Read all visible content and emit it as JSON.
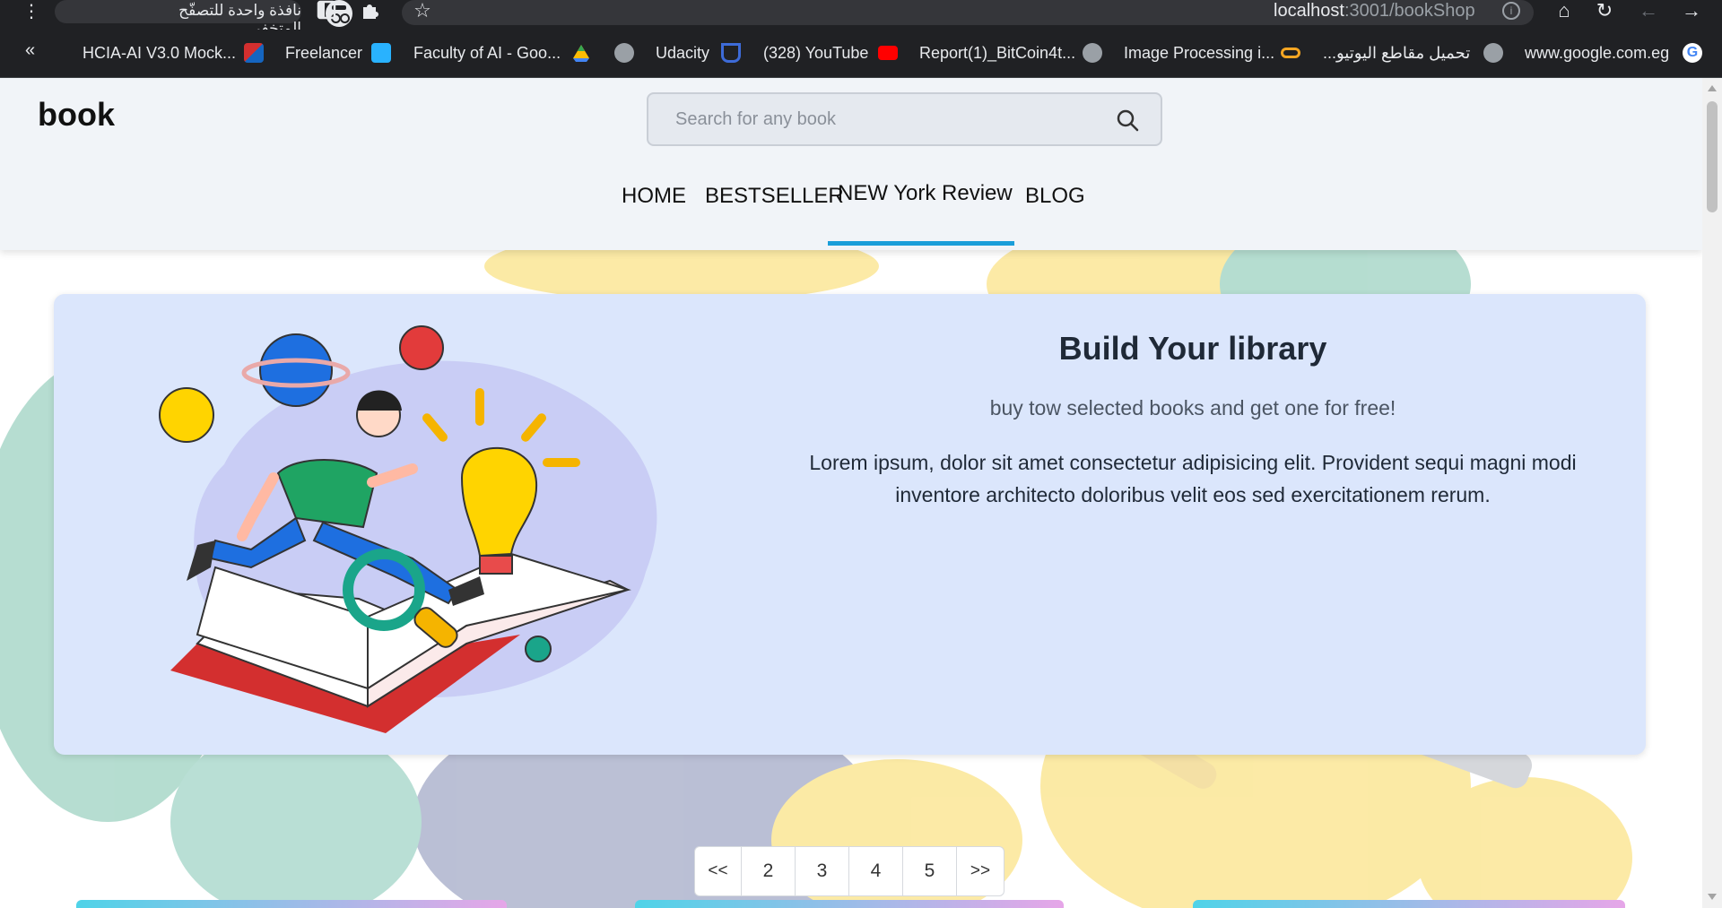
{
  "browser": {
    "incognito_label": "نافذة واحدة للتصفّح المتخفي",
    "url_host": "localhost",
    "url_path": ":3001/bookShop",
    "bookmarks": [
      {
        "label": "HCIA-AI V3.0 Mock...",
        "icon": "huawei-icon"
      },
      {
        "label": "Freelancer",
        "icon": "freelancer-icon"
      },
      {
        "label": "Faculty of AI - Goo...",
        "icon": "google-drive-icon"
      },
      {
        "label": "Udacity",
        "icon": "globe-icon"
      },
      {
        "label": "(328) YouTube",
        "icon": "udacity-icon"
      },
      {
        "label": "Report(1)_BitCoin4t...",
        "icon": "youtube-icon"
      },
      {
        "label": "Image Processing i...",
        "icon": "globe-icon"
      },
      {
        "label": "تحميل مقاطع اليوتيو...",
        "icon": "coursera-icon"
      },
      {
        "label": "www.google.com.eg",
        "icon": "globe-icon"
      }
    ],
    "overflow_chevron": "«"
  },
  "header": {
    "brand": "book",
    "search_placeholder": "Search for any book",
    "nav": [
      {
        "label": "HOME",
        "active": false
      },
      {
        "label": "BESTSELLER",
        "active": false
      },
      {
        "label": "NEW York Review",
        "active": true
      },
      {
        "label": "BLOG",
        "active": false
      }
    ],
    "accent_color": "#1a9ed9"
  },
  "hero": {
    "title": "Build Your library",
    "subtitle": "buy tow selected books and get one for free!",
    "body": "Lorem ipsum, dolor sit amet consectetur adipisicing elit. Provident sequi magni modi inventore architecto doloribus velit eos sed exercitationem rerum.",
    "background": "#dbe6fc"
  },
  "pagination": {
    "prev": "<<",
    "pages": [
      "2",
      "3",
      "4",
      "5"
    ],
    "next": ">>"
  }
}
